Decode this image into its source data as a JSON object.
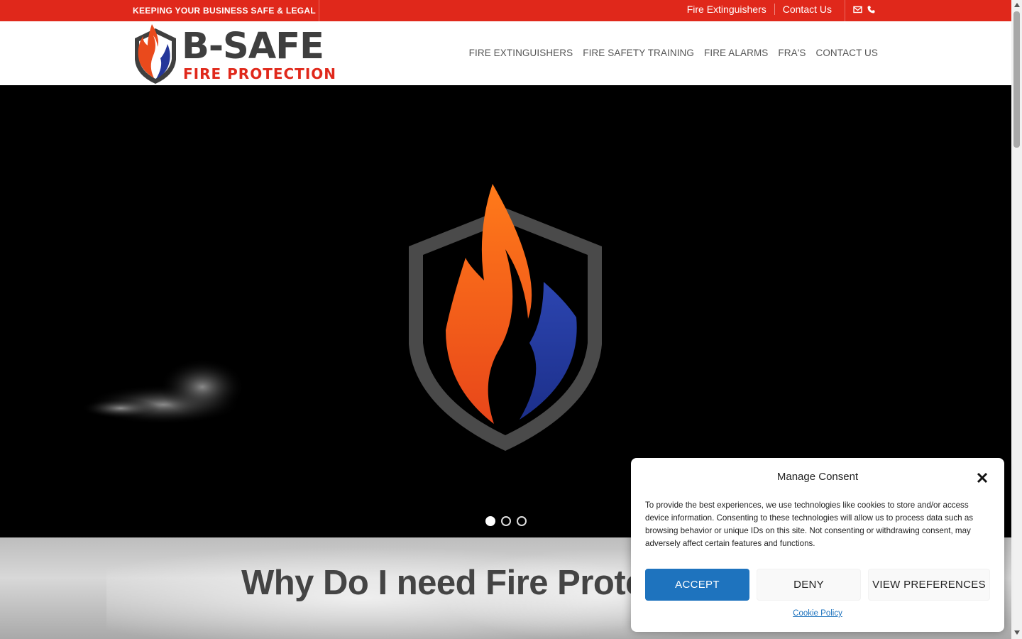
{
  "topbar": {
    "tagline": "KEEPING YOUR BUSINESS SAFE & LEGAL",
    "links": [
      "Fire Extinguishers",
      "Contact Us"
    ],
    "icons": [
      "mail-icon",
      "phone-icon"
    ],
    "color": "#e0281b"
  },
  "logo": {
    "line1": "B-SAFE",
    "line2": "FIRE PROTECTION"
  },
  "nav": {
    "items": [
      "FIRE EXTINGUISHERS",
      "FIRE SAFETY TRAINING",
      "FIRE ALARMS",
      "FRA'S",
      "CONTACT US"
    ]
  },
  "hero": {
    "slide_count": 3,
    "active_slide": 1
  },
  "section": {
    "heading": "Why Do I need Fire Prote"
  },
  "consent": {
    "title": "Manage Consent",
    "body": "To provide the best experiences, we use technologies like cookies to store and/or access device information. Consenting to these technologies will allow us to process data such as browsing behavior or unique IDs on this site. Not consenting or withdrawing consent, may adversely affect certain features and functions.",
    "accept": "ACCEPT",
    "deny": "DENY",
    "preferences": "VIEW PREFERENCES",
    "policy": "Cookie Policy",
    "accent": "#1e73be"
  }
}
